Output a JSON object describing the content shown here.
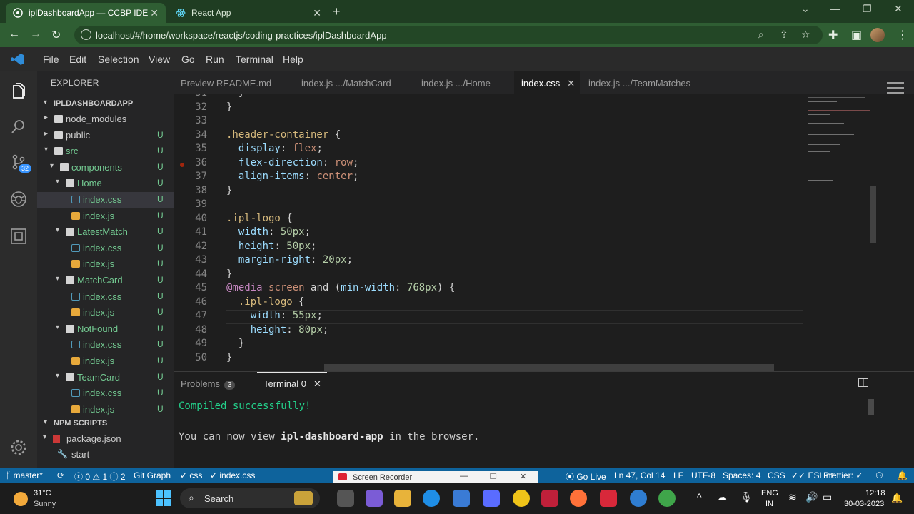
{
  "browser": {
    "tabs": [
      {
        "title": "iplDashboardApp — CCBP IDE",
        "active": true
      },
      {
        "title": "React App",
        "active": false
      }
    ],
    "url": "localhost/#/home/workspace/reactjs/coding-practices/iplDashboardApp"
  },
  "menubar": [
    "File",
    "Edit",
    "Selection",
    "View",
    "Go",
    "Run",
    "Terminal",
    "Help"
  ],
  "activity": {
    "badge": "32"
  },
  "explorer": {
    "title": "EXPLORER",
    "project": "IPLDASHBOARDAPP",
    "npm_scripts": "NPM SCRIPTS",
    "tree": [
      {
        "label": "node_modules",
        "type": "folder",
        "depth": 1,
        "open": false,
        "status": ""
      },
      {
        "label": "public",
        "type": "folder",
        "depth": 1,
        "open": false,
        "status": "U"
      },
      {
        "label": "src",
        "type": "folder",
        "depth": 1,
        "open": true,
        "status": "U"
      },
      {
        "label": "components",
        "type": "folder",
        "depth": 2,
        "open": true,
        "status": "U"
      },
      {
        "label": "Home",
        "type": "folder",
        "depth": 3,
        "open": true,
        "status": "U"
      },
      {
        "label": "index.css",
        "type": "css",
        "depth": 4,
        "status": "U",
        "selected": true
      },
      {
        "label": "index.js",
        "type": "js",
        "depth": 4,
        "status": "U"
      },
      {
        "label": "LatestMatch",
        "type": "folder",
        "depth": 3,
        "open": true,
        "status": "U"
      },
      {
        "label": "index.css",
        "type": "css",
        "depth": 4,
        "status": "U"
      },
      {
        "label": "index.js",
        "type": "js",
        "depth": 4,
        "status": "U"
      },
      {
        "label": "MatchCard",
        "type": "folder",
        "depth": 3,
        "open": true,
        "status": "U"
      },
      {
        "label": "index.css",
        "type": "css",
        "depth": 4,
        "status": "U"
      },
      {
        "label": "index.js",
        "type": "js",
        "depth": 4,
        "status": "U"
      },
      {
        "label": "NotFound",
        "type": "folder",
        "depth": 3,
        "open": true,
        "status": "U"
      },
      {
        "label": "index.css",
        "type": "css",
        "depth": 4,
        "status": "U"
      },
      {
        "label": "index.js",
        "type": "js",
        "depth": 4,
        "status": "U"
      },
      {
        "label": "TeamCard",
        "type": "folder",
        "depth": 3,
        "open": true,
        "status": "U"
      },
      {
        "label": "index.css",
        "type": "css",
        "depth": 4,
        "status": "U"
      },
      {
        "label": "index.js",
        "type": "js",
        "depth": 4,
        "status": "U"
      }
    ],
    "scripts": [
      {
        "label": "package.json"
      },
      {
        "label": "start"
      }
    ]
  },
  "editor_tabs": [
    {
      "label": "Preview README.md",
      "active": false
    },
    {
      "label": "index.js .../MatchCard",
      "active": false
    },
    {
      "label": "index.js .../Home",
      "active": false
    },
    {
      "label": "index.css",
      "active": true
    },
    {
      "label": "index.js .../TeamMatches",
      "active": false
    }
  ],
  "code_lines": [
    {
      "n": "31",
      "t": [
        [
          "  }",
          ""
        ]
      ]
    },
    {
      "n": "32",
      "t": [
        [
          "}",
          ""
        ]
      ]
    },
    {
      "n": "33",
      "t": []
    },
    {
      "n": "34",
      "t": [
        [
          ".header-container",
          "sel"
        ],
        [
          " {",
          ""
        ]
      ]
    },
    {
      "n": "35",
      "t": [
        [
          "  ",
          ""
        ],
        [
          "display",
          "prop"
        ],
        [
          ": ",
          ""
        ],
        [
          "flex",
          "val"
        ],
        [
          ";",
          ""
        ]
      ]
    },
    {
      "n": "36",
      "t": [
        [
          "  ",
          ""
        ],
        [
          "flex-direction",
          "prop"
        ],
        [
          ": ",
          ""
        ],
        [
          "row",
          "val"
        ],
        [
          ";",
          ""
        ]
      ]
    },
    {
      "n": "37",
      "t": [
        [
          "  ",
          ""
        ],
        [
          "align-items",
          "prop"
        ],
        [
          ": ",
          ""
        ],
        [
          "center",
          "val"
        ],
        [
          ";",
          ""
        ]
      ]
    },
    {
      "n": "38",
      "t": [
        [
          "}",
          ""
        ]
      ]
    },
    {
      "n": "39",
      "t": []
    },
    {
      "n": "40",
      "t": [
        [
          ".ipl-logo",
          "sel"
        ],
        [
          " {",
          ""
        ]
      ]
    },
    {
      "n": "41",
      "t": [
        [
          "  ",
          ""
        ],
        [
          "width",
          "prop"
        ],
        [
          ": ",
          ""
        ],
        [
          "50px",
          "num"
        ],
        [
          ";",
          ""
        ]
      ]
    },
    {
      "n": "42",
      "t": [
        [
          "  ",
          ""
        ],
        [
          "height",
          "prop"
        ],
        [
          ": ",
          ""
        ],
        [
          "50px",
          "num"
        ],
        [
          ";",
          ""
        ]
      ]
    },
    {
      "n": "43",
      "t": [
        [
          "  ",
          ""
        ],
        [
          "margin-right",
          "prop"
        ],
        [
          ": ",
          ""
        ],
        [
          "20px",
          "num"
        ],
        [
          ";",
          ""
        ]
      ]
    },
    {
      "n": "44",
      "t": [
        [
          "}",
          ""
        ]
      ]
    },
    {
      "n": "45",
      "t": [
        [
          "@media",
          "at"
        ],
        [
          " ",
          ""
        ],
        [
          "screen",
          "val"
        ],
        [
          " and (",
          ""
        ],
        [
          "min-width",
          "prop"
        ],
        [
          ": ",
          ""
        ],
        [
          "768px",
          "num"
        ],
        [
          ") {",
          ""
        ]
      ]
    },
    {
      "n": "46",
      "t": [
        [
          "  ",
          ""
        ],
        [
          ".ipl-logo",
          "sel"
        ],
        [
          " {",
          ""
        ]
      ]
    },
    {
      "n": "47",
      "t": [
        [
          "    ",
          ""
        ],
        [
          "width",
          "prop"
        ],
        [
          ": ",
          ""
        ],
        [
          "55px",
          "num"
        ],
        [
          ";",
          ""
        ]
      ]
    },
    {
      "n": "48",
      "t": [
        [
          "    ",
          ""
        ],
        [
          "height",
          "prop"
        ],
        [
          ": ",
          ""
        ],
        [
          "80px",
          "num"
        ],
        [
          ";",
          ""
        ]
      ]
    },
    {
      "n": "49",
      "t": [
        [
          "  }",
          ""
        ]
      ]
    },
    {
      "n": "50",
      "t": [
        [
          "}",
          ""
        ]
      ]
    }
  ],
  "panel": {
    "tabs": [
      {
        "label": "Problems",
        "badge": "3"
      },
      {
        "label": "Terminal 0",
        "active": true
      }
    ],
    "lines": [
      {
        "text": "Compiled successfully!",
        "cls": "green"
      },
      {
        "text": "",
        "cls": "plain"
      },
      {
        "prefix": "You can now view ",
        "bold": "ipl-dashboard-app",
        "suffix": " in the browser."
      }
    ]
  },
  "statusbar": {
    "branch": "master*",
    "errors": "0",
    "warnings": "1",
    "info": "2",
    "git_graph": "Git Graph",
    "lang_crumb": "css",
    "file_crumb": "index.css",
    "recorder": "Screen Recorder",
    "go_live": "Go Live",
    "position": "Ln 47, Col 14",
    "eol": "LF",
    "encoding": "UTF-8",
    "spaces": "Spaces: 4",
    "language": "CSS",
    "eslint": "ESLint",
    "prettier": "Prettier: ✓"
  },
  "taskbar": {
    "temp": "31°C",
    "weather": "Sunny",
    "search": "Search",
    "lang1": "ENG",
    "lang2": "IN",
    "time": "12:18",
    "date": "30-03-2023"
  },
  "colors": {
    "accent": "#0e639c",
    "browser_frame": "#2f5e33",
    "terminal_green": "#23d18b"
  }
}
